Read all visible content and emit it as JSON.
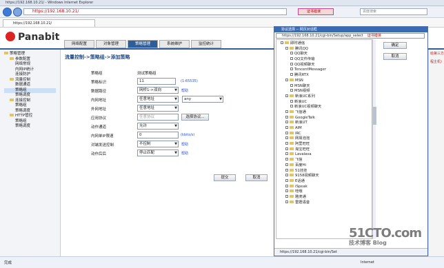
{
  "browser": {
    "title": "https://192.168.10.21/ - Windows Internet Explorer",
    "address": "https://192.168.10.21/",
    "cert_text": "证书错误",
    "search_placeholder": "百度搜索",
    "tab_label": "https://192.168.10.21/"
  },
  "app": {
    "logo_text": "Panabit",
    "nav": [
      "网络配置",
      "对象管理",
      "策略管理",
      "系统维护",
      "监控统计"
    ],
    "active_nav_index": 2
  },
  "sidebar": {
    "items": [
      {
        "label": "策略管理",
        "level": 0,
        "folder": true
      },
      {
        "label": "参数配置",
        "level": 1,
        "folder": true
      },
      {
        "label": "网络常规",
        "level": 2
      },
      {
        "label": "内网IP统计",
        "level": 2
      },
      {
        "label": "连接防护",
        "level": 2
      },
      {
        "label": "流量控制",
        "level": 1,
        "folder": true
      },
      {
        "label": "数据通道",
        "level": 2
      },
      {
        "label": "策略组",
        "level": 2,
        "selected": true
      },
      {
        "label": "策略调度",
        "level": 2
      },
      {
        "label": "连接控制",
        "level": 1,
        "folder": true
      },
      {
        "label": "策略组",
        "level": 2
      },
      {
        "label": "策略调度",
        "level": 2
      },
      {
        "label": "HTTP管控",
        "level": 1,
        "folder": true
      },
      {
        "label": "策略组",
        "level": 2
      },
      {
        "label": "策略调度",
        "level": 2
      }
    ]
  },
  "main": {
    "breadcrumb": "流量控制->策略组->添加策略",
    "form": {
      "group_label": "策略组",
      "group_value": "测试策略组",
      "id_label": "策略标识",
      "id_value": "11",
      "id_hint": "(1-65535)",
      "path_label": "数据路径",
      "path_value": "网桥1->双向",
      "path_help": "帮助",
      "intranet_label": "内网地址",
      "intranet_value": "任意地址",
      "intranet_value2": "any",
      "extranet_label": "外网地址",
      "extranet_value": "任意地址",
      "app_label": "应用协议",
      "app_placeholder": "任意协议",
      "app_button": "选择协议...",
      "action_label": "动作通道",
      "action_value": "允许",
      "speed_label": "内网单IP限速",
      "speed_value": "0",
      "speed_hint": "(kbits/s)",
      "dscp_label": "对端发送控制",
      "dscp_value": "不控制",
      "dscp_help": "帮助",
      "after_label": "动作后后",
      "after_value": "停止匹配",
      "after_help": "帮助",
      "submit": "提交",
      "cancel": "取消"
    }
  },
  "dialog": {
    "title": "协议选择 -- 网页对话框",
    "address": "https://192.168.10.21/cgi-bin/Setup/app_select",
    "cert_text": "证书错误",
    "ok": "确定",
    "cancel": "取消",
    "status_url": "https://192.168.10.21/cgi-bin/Set",
    "items": [
      {
        "label": "即时通信",
        "level": 0
      },
      {
        "label": "腾讯QQ",
        "level": 1
      },
      {
        "label": "QQ聊天",
        "level": 2
      },
      {
        "label": "QQ文件传输",
        "level": 2
      },
      {
        "label": "QQ视频聊天",
        "level": 2
      },
      {
        "label": "TencentMessager",
        "level": 2
      },
      {
        "label": "腾讯RTX",
        "level": 2
      },
      {
        "label": "MSN",
        "level": 1
      },
      {
        "label": "MSN聊天",
        "level": 2
      },
      {
        "label": "MSN视频",
        "level": 2
      },
      {
        "label": "新浪UC系列",
        "level": 1
      },
      {
        "label": "新浪UC",
        "level": 2
      },
      {
        "label": "新浪UC视频聊天",
        "level": 2
      },
      {
        "label": "飞信通",
        "level": 1
      },
      {
        "label": "GoogleTalk",
        "level": 1
      },
      {
        "label": "新浪UT",
        "level": 1
      },
      {
        "label": "AIM",
        "level": 1
      },
      {
        "label": "IRC",
        "level": 1
      },
      {
        "label": "网易泡泡",
        "level": 1
      },
      {
        "label": "阿里旺旺",
        "level": 1
      },
      {
        "label": "淘宝旺旺",
        "level": 1
      },
      {
        "label": "Lavalava",
        "level": 1
      },
      {
        "label": "飞信",
        "level": 1
      },
      {
        "label": "百度Hi",
        "level": 1
      },
      {
        "label": "51挂挂",
        "level": 1
      },
      {
        "label": "9158视频聊天",
        "level": 1
      },
      {
        "label": "E话通",
        "level": 1
      },
      {
        "label": "iSpeak",
        "level": 1
      },
      {
        "label": "哇哦",
        "level": 1
      },
      {
        "label": "雅虎通",
        "level": 1
      },
      {
        "label": "雷霆语音",
        "level": 1
      }
    ]
  },
  "background": {
    "right_text1": "给第三方",
    "right_text2": "程主机)"
  },
  "statusbar": {
    "left": "完成",
    "middle": "Internet"
  },
  "watermark": {
    "line1": "51CTO.com",
    "line2": "技术博客 Blog"
  }
}
